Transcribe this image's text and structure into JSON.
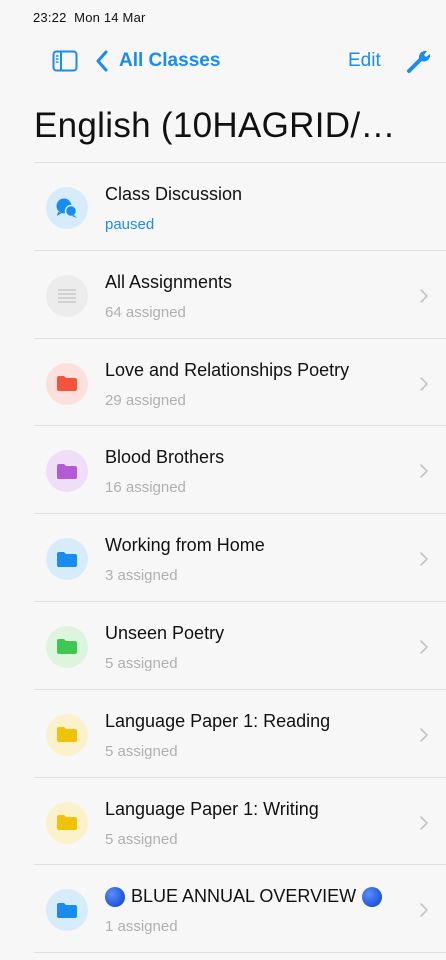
{
  "status": {
    "time": "23:22",
    "date": "Mon 14 Mar"
  },
  "nav": {
    "back_label": "All Classes",
    "edit_label": "Edit"
  },
  "page": {
    "title": "English (10HAGRID/…"
  },
  "rows": [
    {
      "title": "Class Discussion",
      "subtitle": "paused",
      "icon": "chat-bubbles-icon",
      "badge_bg": "#d6ecfb",
      "icon_color": "#1a8cf0",
      "subtitle_color": "blue",
      "chevron": false
    },
    {
      "title": "All Assignments",
      "subtitle": "64 assigned",
      "icon": "list-lines-icon",
      "badge_bg": "#ececec",
      "icon_color": "#c9c9c9",
      "chevron": true
    },
    {
      "title": "Love and Relationships Poetry",
      "subtitle": "29 assigned",
      "icon": "folder-icon",
      "badge_bg": "#fde0dc",
      "icon_color": "#f2543e",
      "chevron": true
    },
    {
      "title": "Blood Brothers",
      "subtitle": "16 assigned",
      "icon": "folder-icon",
      "badge_bg": "#f0ddf7",
      "icon_color": "#b35ad6",
      "chevron": true
    },
    {
      "title": "Working from Home",
      "subtitle": "3 assigned",
      "icon": "folder-icon",
      "badge_bg": "#d6ecfb",
      "icon_color": "#1a8cf0",
      "chevron": true
    },
    {
      "title": "Unseen Poetry",
      "subtitle": "5 assigned",
      "icon": "folder-icon",
      "badge_bg": "#dcf5dc",
      "icon_color": "#3fc753",
      "chevron": true
    },
    {
      "title": "Language Paper 1: Reading",
      "subtitle": "5 assigned",
      "icon": "folder-icon",
      "badge_bg": "#fbf2cc",
      "icon_color": "#f0c20a",
      "chevron": true
    },
    {
      "title": "Language Paper 1: Writing",
      "subtitle": "5 assigned",
      "icon": "folder-icon",
      "badge_bg": "#fbf2cc",
      "icon_color": "#f0c20a",
      "chevron": true
    },
    {
      "title": "BLUE ANNUAL OVERVIEW",
      "subtitle": "1 assigned",
      "icon": "folder-icon",
      "badge_bg": "#d6ecfb",
      "icon_color": "#1a8cf0",
      "chevron": true,
      "blue_dots": true
    }
  ],
  "colors": {
    "accent": "#1a8cf0",
    "separator": "#dedede",
    "subtitle_gray": "#b0b0b0"
  }
}
